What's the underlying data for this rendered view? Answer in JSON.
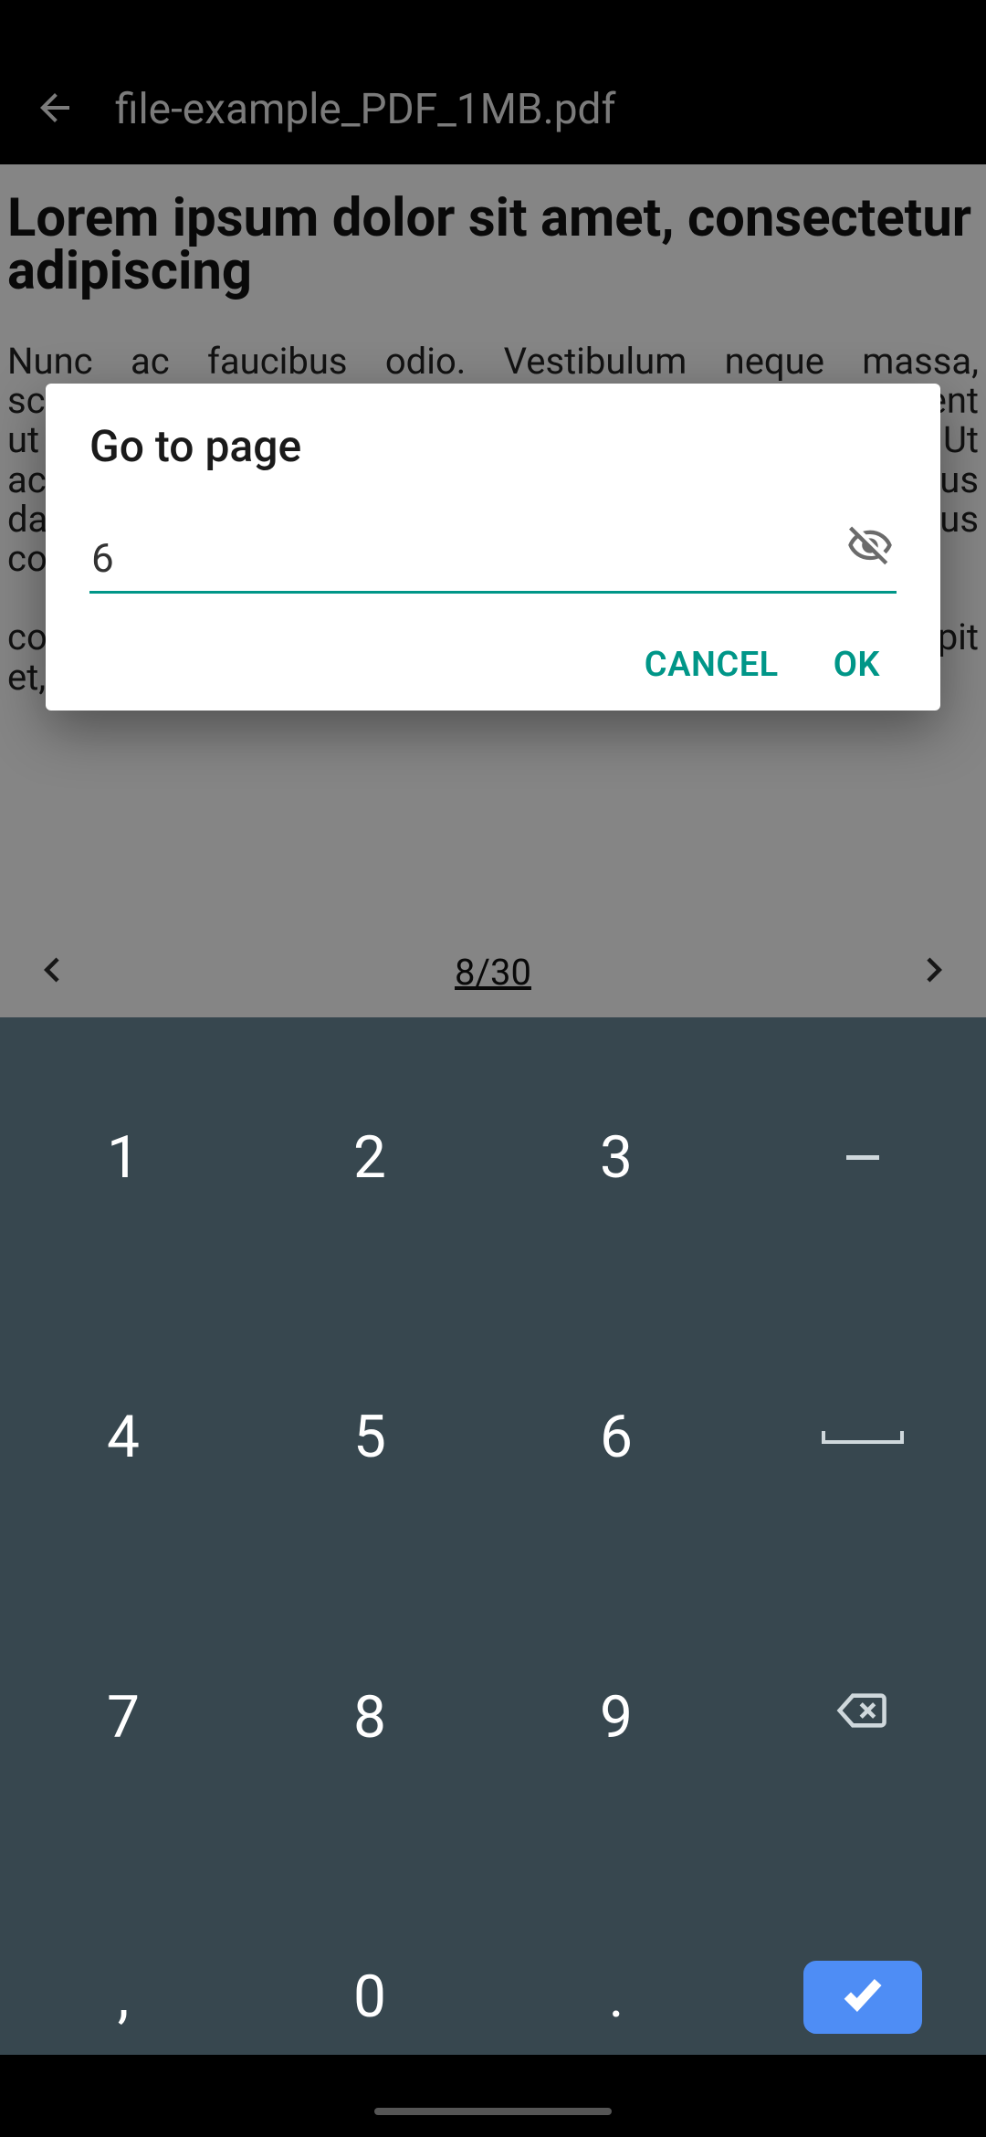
{
  "header": {
    "title": "file-example_PDF_1MB.pdf"
  },
  "document": {
    "heading": "Lorem ipsum dolor sit amet, consectetur adipiscing",
    "body": "Nunc ac faucibus odio. Vestibulum neque massa, scelerisque sit amet ligula eu, congue molestie mi. Praesent ut varius sem. Nullam at porttitor arcu, nec lacinia nisi. Ut ac dolor vitae odio interdum condimentum. Vivamus dapibus sodales ex, vitae malesuada ipsum cursus convallis. Maecenas sed egestas nulla, ac\n\ncondimentum orci. Mauris diam felis, vulputate ac suscipit et, iaculis non est."
  },
  "pager": {
    "indicator": "8/30"
  },
  "dialog": {
    "title": "Go to page",
    "input_value": "6",
    "cancel_label": "CANCEL",
    "ok_label": "OK"
  },
  "keypad": {
    "rows": [
      [
        "1",
        "2",
        "3",
        "dash"
      ],
      [
        "4",
        "5",
        "6",
        "space"
      ],
      [
        "7",
        "8",
        "9",
        "backspace"
      ],
      [
        ",",
        "0",
        ".",
        "enter"
      ]
    ],
    "labels": {
      "comma": ",",
      "zero": "0",
      "dot": "."
    }
  },
  "colors": {
    "accent": "#009688",
    "enter": "#4e8df5",
    "keypad_bg": "#37474f"
  }
}
